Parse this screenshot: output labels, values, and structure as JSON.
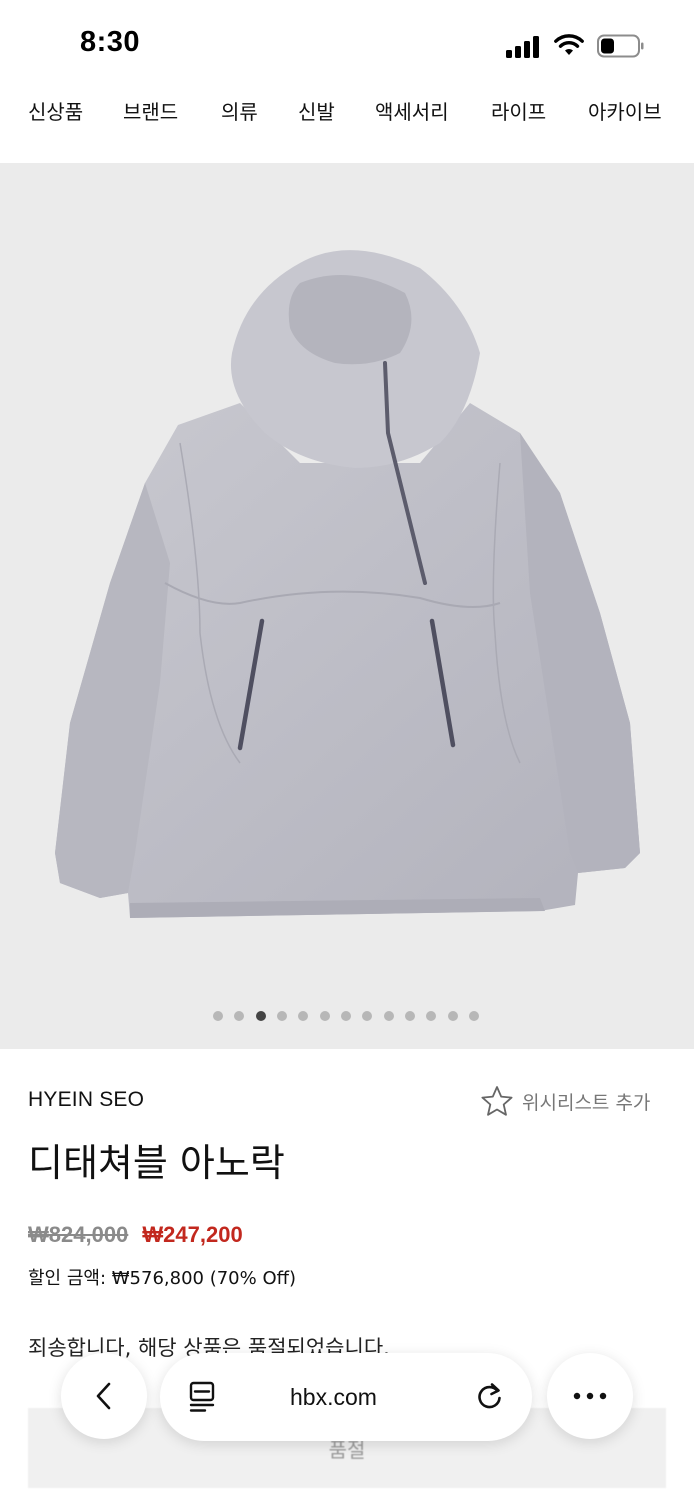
{
  "status_bar": {
    "time": "8:30"
  },
  "nav": {
    "items": [
      {
        "label": "신상품"
      },
      {
        "label": "브랜드"
      },
      {
        "label": "의류"
      },
      {
        "label": "신발"
      },
      {
        "label": "액세서리"
      },
      {
        "label": "라이프"
      },
      {
        "label": "아카이브"
      }
    ]
  },
  "gallery": {
    "total_images": 13,
    "active_index": 2
  },
  "product": {
    "brand": "HYEIN SEO",
    "wishlist_label": "위시리스트 추가",
    "name": "디태쳐블 아노락",
    "original_price": "₩824,000",
    "sale_price": "₩247,200",
    "discount_text": "할인 금액: ₩576,800 (70% Off)",
    "soldout_message": "죄송합니다, 해당 상품은 품절되었습니다.",
    "soldout_button": "품절"
  },
  "browser": {
    "url": "hbx.com"
  },
  "colors": {
    "sale_red": "#c2281e",
    "image_bg": "#ebebeb",
    "active_dot": "#444444"
  },
  "icons": [
    "back-icon",
    "reader-mode-icon",
    "reload-icon",
    "more-icon",
    "star-icon",
    "signal-icon",
    "wifi-icon",
    "battery-icon"
  ]
}
